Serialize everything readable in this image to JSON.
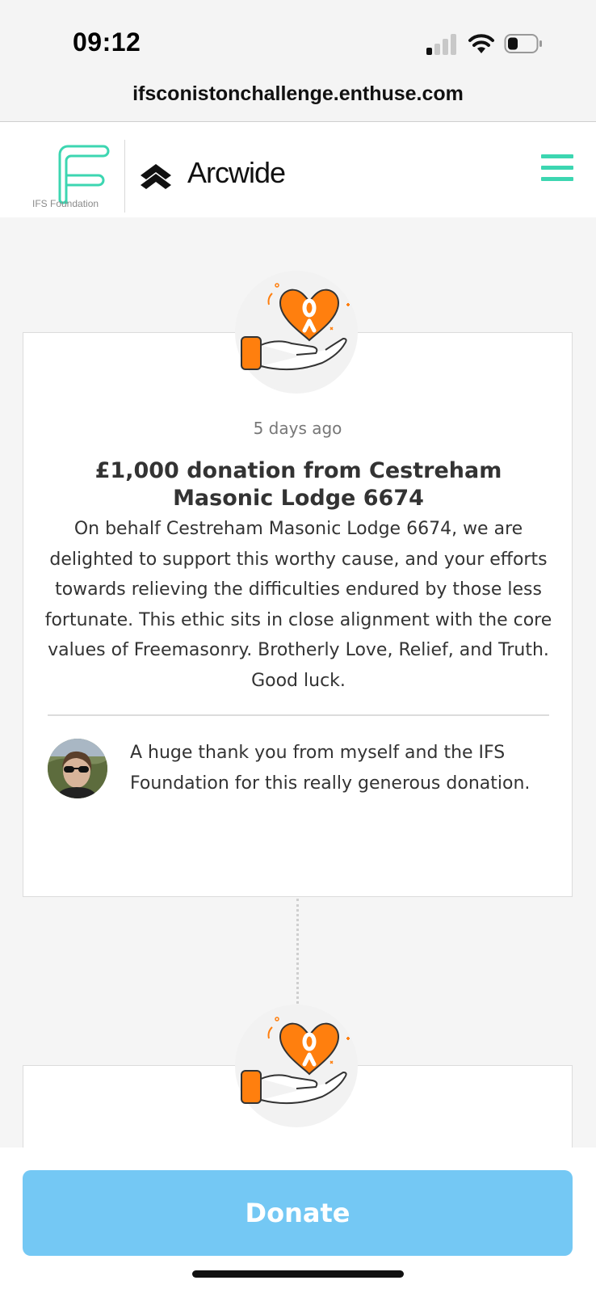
{
  "status_bar": {
    "time": "09:12"
  },
  "browser": {
    "url": "ifsconistonchallenge.enthuse.com"
  },
  "header": {
    "ifs_caption": "IFS Foundation",
    "brand_name": "Arcwide",
    "accent_color": "#3cd6b1"
  },
  "feed": {
    "items": [
      {
        "time_ago": "5 days ago",
        "title": "£1,000 donation from Cestreham Masonic Lodge 6674",
        "message": "On behalf Cestreham Masonic Lodge 6674, we are delighted to support this worthy cause, and your efforts towards relieving the difficulties endured by those less fortunate. This ethic sits in close alignment with the core values of Freemasonry. Brotherly Love, Relief, and Truth. Good luck.",
        "reply": "A huge thank you from myself and the IFS Foundation for this really generous donation."
      }
    ],
    "badge_icon": "heart-in-hand-icon",
    "badge_color": "#ff7f0e"
  },
  "footer": {
    "donate_label": "Donate",
    "donate_color": "#74c8f4"
  }
}
